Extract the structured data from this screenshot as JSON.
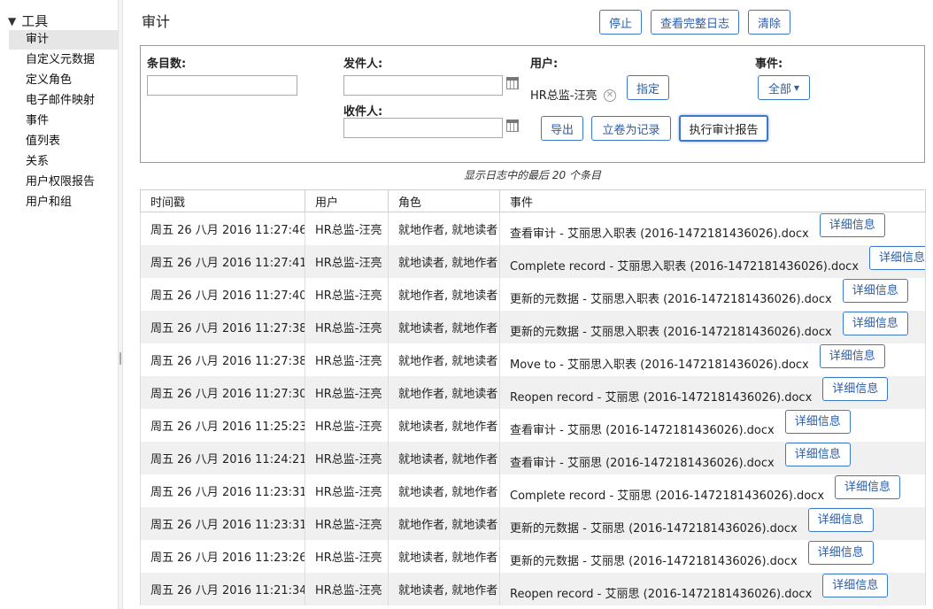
{
  "sidebar": {
    "header": "工具",
    "items": [
      {
        "label": "审计",
        "selected": true
      },
      {
        "label": "自定义元数据"
      },
      {
        "label": "定义角色"
      },
      {
        "label": "电子邮件映射"
      },
      {
        "label": "事件"
      },
      {
        "label": "值列表"
      },
      {
        "label": "关系"
      },
      {
        "label": "用户权限报告"
      },
      {
        "label": "用户和组"
      }
    ]
  },
  "page": {
    "title": "审计",
    "buttons": {
      "stop": "停止",
      "view_full_log": "查看完整日志",
      "clear": "清除"
    }
  },
  "filters": {
    "count_label": "条目数:",
    "count_value": "",
    "sender_label": "发件人:",
    "sender_value": "",
    "recipient_label": "收件人:",
    "recipient_value": "",
    "user_label": "用户:",
    "user_value": "HR总监-汪亮",
    "assign_label": "指定",
    "event_label": "事件:",
    "event_select": "全部",
    "export_label": "导出",
    "declare_record_label": "立卷为记录",
    "run_report_label": "执行审计报告"
  },
  "caption": "显示日志中的最后 20 个条目",
  "table": {
    "columns": [
      "时间戳",
      "用户",
      "角色",
      "事件"
    ],
    "detail_label": "详细信息",
    "rows": [
      {
        "time": "周五 26 八月 2016 11:27:46",
        "user": "HR总监-汪亮",
        "role": "就地作者, 就地读者",
        "event": "查看审计 - 艾丽思入职表 (2016-1472181436026).docx"
      },
      {
        "time": "周五 26 八月 2016 11:27:41",
        "user": "HR总监-汪亮",
        "role": "就地读者, 就地作者",
        "event": "Complete record - 艾丽思入职表 (2016-1472181436026).docx"
      },
      {
        "time": "周五 26 八月 2016 11:27:40",
        "user": "HR总监-汪亮",
        "role": "就地作者, 就地读者",
        "event": "更新的元数据 - 艾丽思入职表 (2016-1472181436026).docx"
      },
      {
        "time": "周五 26 八月 2016 11:27:38",
        "user": "HR总监-汪亮",
        "role": "就地读者, 就地作者",
        "event": "更新的元数据 - 艾丽思入职表 (2016-1472181436026).docx"
      },
      {
        "time": "周五 26 八月 2016 11:27:38",
        "user": "HR总监-汪亮",
        "role": "就地作者, 就地读者",
        "event": "Move to - 艾丽思入职表 (2016-1472181436026).docx"
      },
      {
        "time": "周五 26 八月 2016 11:27:30",
        "user": "HR总监-汪亮",
        "role": "就地作者, 就地读者",
        "event": "Reopen record - 艾丽思 (2016-1472181436026).docx"
      },
      {
        "time": "周五 26 八月 2016 11:25:23",
        "user": "HR总监-汪亮",
        "role": "就地读者, 就地作者",
        "event": "查看审计 - 艾丽思 (2016-1472181436026).docx"
      },
      {
        "time": "周五 26 八月 2016 11:24:21",
        "user": "HR总监-汪亮",
        "role": "就地读者, 就地作者",
        "event": "查看审计 - 艾丽思 (2016-1472181436026).docx"
      },
      {
        "time": "周五 26 八月 2016 11:23:31",
        "user": "HR总监-汪亮",
        "role": "就地读者, 就地作者",
        "event": "Complete record - 艾丽思 (2016-1472181436026).docx"
      },
      {
        "time": "周五 26 八月 2016 11:23:31",
        "user": "HR总监-汪亮",
        "role": "就地作者, 就地读者",
        "event": "更新的元数据 - 艾丽思 (2016-1472181436026).docx"
      },
      {
        "time": "周五 26 八月 2016 11:23:26",
        "user": "HR总监-汪亮",
        "role": "就地读者, 就地作者",
        "event": "更新的元数据 - 艾丽思 (2016-1472181436026).docx"
      },
      {
        "time": "周五 26 八月 2016 11:21:34",
        "user": "HR总监-汪亮",
        "role": "就地读者, 就地作者",
        "event": "Reopen record - 艾丽思 (2016-1472181436026).docx"
      }
    ]
  },
  "colors": {
    "accent": "#3b78c9",
    "selected_bg": "#e6e6e6",
    "stripe": "#f0f0f0"
  }
}
